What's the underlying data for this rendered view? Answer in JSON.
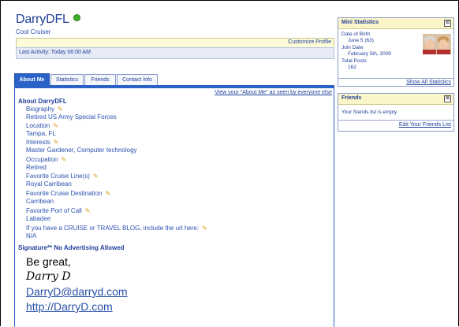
{
  "profile": {
    "username": "DarryDFL",
    "subtitle": "Cool Cruiser",
    "customize_label": "Customize Profile",
    "last_activity": "Last Activity: Today 06:00 AM"
  },
  "tabs": [
    {
      "label": "About Me",
      "active": true
    },
    {
      "label": "Statistics",
      "active": false
    },
    {
      "label": "Friends",
      "active": false
    },
    {
      "label": "Contact Info",
      "active": false
    }
  ],
  "about": {
    "view_as_label": "View your \"About Me\" as seen by everyone else",
    "heading": "About DarryDFL",
    "fields": [
      {
        "label": "Biography",
        "value": "Retired US Army Special Forces"
      },
      {
        "label": "Location",
        "value": "Tampa, FL"
      },
      {
        "label": "Interests",
        "value": "Master Gardener, Computer technology"
      },
      {
        "label": "Occupation",
        "value": "Retired"
      },
      {
        "label": "Favorite Cruise Line(s)",
        "value": "Royal Carribean"
      },
      {
        "label": "Favorite Cruise Destination",
        "value": "Carribean"
      },
      {
        "label": "Favorite Port of Call",
        "value": "Labadee"
      },
      {
        "label": "If you have a CRUISE or TRAVEL BLOG, include the url here:",
        "value": "N/A"
      }
    ]
  },
  "signature": {
    "heading": "Signature** No Advertising Allowed",
    "line1": "Be great,",
    "line2": "Darry D",
    "line3": "DarryD@darryd.com",
    "line4": "http://DarryD.com"
  },
  "mini_stats": {
    "title": "Mini Statistics",
    "close_glyph": "⊠",
    "dob_label": "Date of Birth",
    "dob_value": "June 5 (63)",
    "join_label": "Join Date",
    "join_value": "February 5th, 2009",
    "posts_label": "Total Posts",
    "posts_value": "162",
    "show_all": "Show All Statistics"
  },
  "friends_panel": {
    "title": "Friends",
    "close_glyph": "⊠",
    "empty_text": "Your friends list is empty",
    "edit_link": "Edit Your Friends List"
  },
  "icons": {
    "edit": "pencil-icon",
    "online": "online-status-icon"
  },
  "colors": {
    "accent": "#2a62c8",
    "link": "#22409a",
    "header_bg": "#fbf6c7",
    "online": "#3fae2a"
  }
}
